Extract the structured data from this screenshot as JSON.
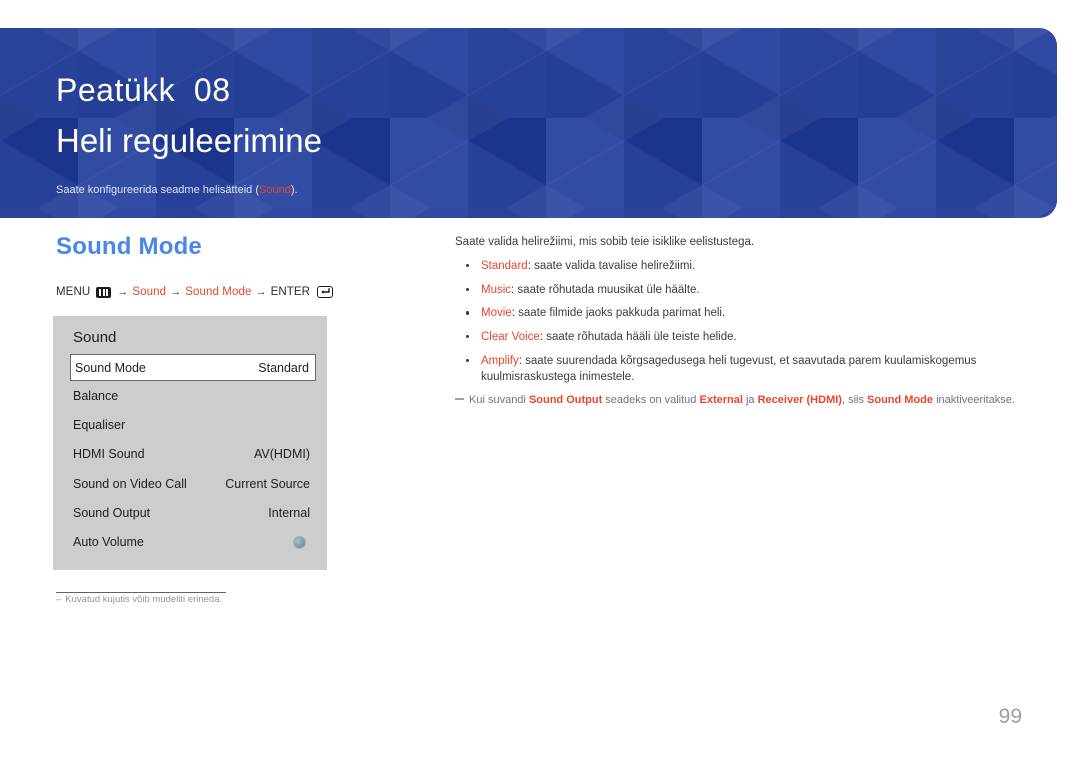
{
  "banner": {
    "chapter_label": "Peatükk  08",
    "chapter_title": "Heli reguleerimine",
    "subtitle_before": "Saate konfigureerida seadme helisätteid (",
    "subtitle_accent": "Sound",
    "subtitle_after": ").",
    "background_color": "#1f3b9b",
    "accent_color": "#e8452c"
  },
  "section": {
    "heading": "Sound Mode",
    "heading_color": "#4a86e8"
  },
  "menu_path": {
    "menu_label": "MENU",
    "menu_icon": "menu-icon",
    "arrow": "→",
    "step1": "Sound",
    "step2": "Sound Mode",
    "enter_label": "ENTER",
    "enter_icon": "enter-icon"
  },
  "osd": {
    "title": "Sound",
    "rows": [
      {
        "label": "Sound Mode",
        "value": "Standard",
        "selected": true,
        "type": "value"
      },
      {
        "label": "Balance",
        "value": "",
        "selected": false,
        "type": "value"
      },
      {
        "label": "Equaliser",
        "value": "",
        "selected": false,
        "type": "value"
      },
      {
        "label": "HDMI Sound",
        "value": "AV(HDMI)",
        "selected": false,
        "type": "value"
      },
      {
        "label": "Sound on Video Call",
        "value": "Current Source",
        "selected": false,
        "type": "value"
      },
      {
        "label": "Sound Output",
        "value": "Internal",
        "selected": false,
        "type": "value"
      },
      {
        "label": "Auto Volume",
        "value": "",
        "selected": false,
        "type": "toggle"
      }
    ],
    "background_color": "#cdcdcd"
  },
  "footnote": {
    "dash": "–",
    "text": "Kuvatud kujutis võib mudeliti erineda."
  },
  "content": {
    "lead": "Saate valida helirežiimi, mis sobib teie isiklike eelistustega.",
    "bullets": [
      {
        "term": "Standard",
        "text": ": saate valida tavalise helirežiimi."
      },
      {
        "term": "Music",
        "text": ": saate rõhutada muusikat üle häälte."
      },
      {
        "term": "Movie",
        "text": ": saate filmide jaoks pakkuda parimat heli."
      },
      {
        "term": "Clear Voice",
        "text": ": saate rõhutada hääli üle teiste helide."
      },
      {
        "term": "Amplify",
        "text": ": saate suurendada kõrgsagedusega heli tugevust, et saavutada parem kuulamiskogemus kuulmisraskustega inimestele."
      }
    ],
    "note": {
      "p1": "Kui suvandi ",
      "t1": "Sound Output",
      "p2": " seadeks on valitud ",
      "t2": "External",
      "p3": " ja ",
      "t3": "Receiver (HDMI)",
      "p4": ", siis ",
      "t4": "Sound Mode",
      "p5": " inaktiveeritakse."
    }
  },
  "page_number": "99"
}
